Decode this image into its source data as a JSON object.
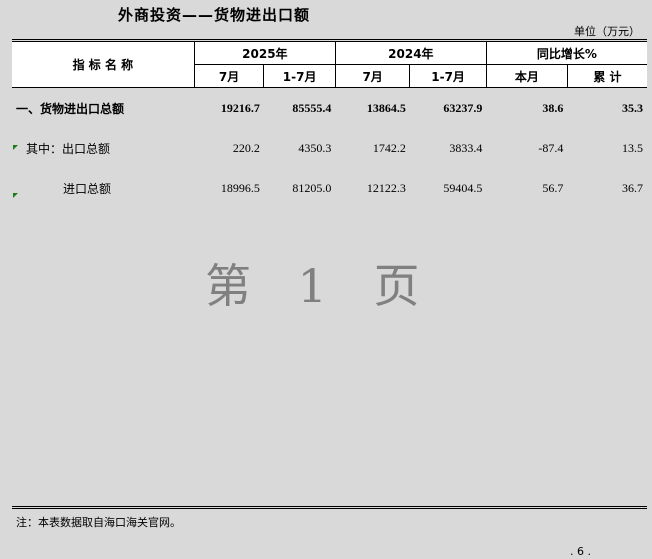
{
  "title": "外商投资——货物进出口额",
  "unit": "单位（万元）",
  "header": {
    "indicator": "指 标 名 称",
    "year_2025": "2025年",
    "year_2024": "2024年",
    "yoy": "同比增长%",
    "m7": "7月",
    "m1_7": "1-7月",
    "this_month": "本月",
    "cumulative": "累 计"
  },
  "rows": [
    {
      "label": "一、货物进出口总额",
      "v2025_7": "19216.7",
      "v2025_17": "85555.4",
      "v2024_7": "13864.5",
      "v2024_17": "63237.9",
      "yoy_m": "38.6",
      "yoy_c": "35.3"
    },
    {
      "label": "其中：出口总额",
      "v2025_7": "220.2",
      "v2025_17": "4350.3",
      "v2024_7": "1742.2",
      "v2024_17": "3833.4",
      "yoy_m": "-87.4",
      "yoy_c": "13.5"
    },
    {
      "label": "进口总额",
      "v2025_7": "18996.5",
      "v2025_17": "81205.0",
      "v2024_7": "12122.3",
      "v2024_17": "59404.5",
      "yoy_m": "56.7",
      "yoy_c": "36.7"
    }
  ],
  "watermark": "第 1 页",
  "note": "注：本表数据取自海口海关官网。",
  "page_number": ". 6 ."
}
